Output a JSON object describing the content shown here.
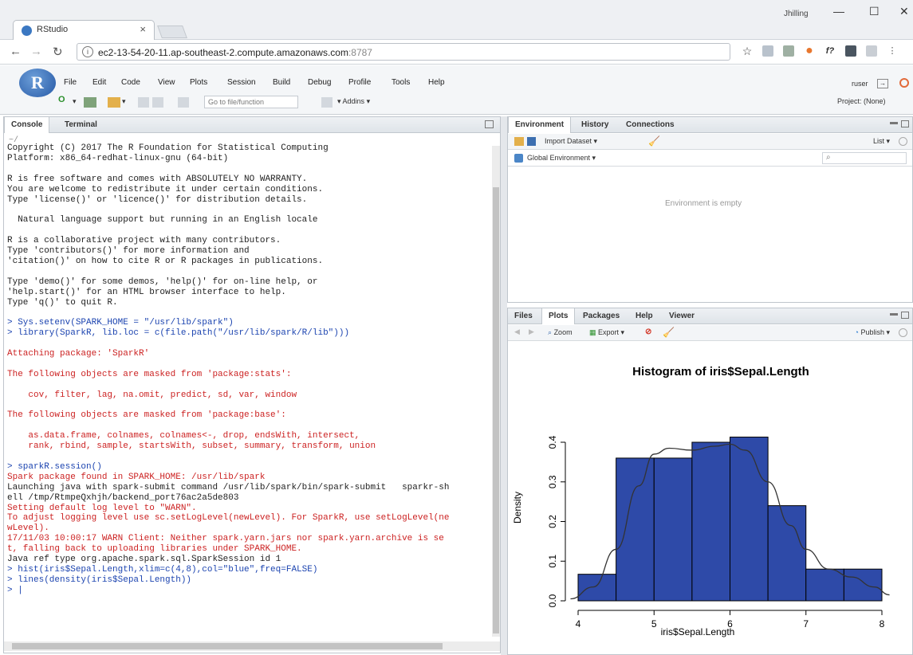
{
  "browser": {
    "tab_title": "RStudio",
    "tab_close": "×",
    "profile": "Jhilling",
    "win_minimize": "—",
    "win_maximize": "☐",
    "win_close": "✕",
    "url_host": "ec2-13-54-20-11.ap-southeast-2.compute.amazonaws.com",
    "url_port": ":8787"
  },
  "rstudio": {
    "menu": [
      "File",
      "Edit",
      "Code",
      "View",
      "Plots",
      "Session",
      "Build",
      "Debug",
      "Profile",
      "Tools",
      "Help"
    ],
    "goto_file": "Go to file/function",
    "addins": "Addins",
    "user": "ruser",
    "project": "Project: (None)"
  },
  "console": {
    "tabs": [
      "Console",
      "Terminal"
    ],
    "path": "~/",
    "lines": [
      {
        "t": "Copyright (C) 2017 The R Foundation for Statistical Computing",
        "c": "n"
      },
      {
        "t": "Platform: x86_64-redhat-linux-gnu (64-bit)",
        "c": "n"
      },
      {
        "t": "",
        "c": "n"
      },
      {
        "t": "R is free software and comes with ABSOLUTELY NO WARRANTY.",
        "c": "n"
      },
      {
        "t": "You are welcome to redistribute it under certain conditions.",
        "c": "n"
      },
      {
        "t": "Type 'license()' or 'licence()' for distribution details.",
        "c": "n"
      },
      {
        "t": "",
        "c": "n"
      },
      {
        "t": "  Natural language support but running in an English locale",
        "c": "n"
      },
      {
        "t": "",
        "c": "n"
      },
      {
        "t": "R is a collaborative project with many contributors.",
        "c": "n"
      },
      {
        "t": "Type 'contributors()' for more information and",
        "c": "n"
      },
      {
        "t": "'citation()' on how to cite R or R packages in publications.",
        "c": "n"
      },
      {
        "t": "",
        "c": "n"
      },
      {
        "t": "Type 'demo()' for some demos, 'help()' for on-line help, or",
        "c": "n"
      },
      {
        "t": "'help.start()' for an HTML browser interface to help.",
        "c": "n"
      },
      {
        "t": "Type 'q()' to quit R.",
        "c": "n"
      },
      {
        "t": "",
        "c": "n"
      },
      {
        "t": "> Sys.setenv(SPARK_HOME = \"/usr/lib/spark\")",
        "c": "b"
      },
      {
        "t": "> library(SparkR, lib.loc = c(file.path(\"/usr/lib/spark/R/lib\")))",
        "c": "b"
      },
      {
        "t": "",
        "c": "n"
      },
      {
        "t": "Attaching package: 'SparkR'",
        "c": "r"
      },
      {
        "t": "",
        "c": "n"
      },
      {
        "t": "The following objects are masked from 'package:stats':",
        "c": "r"
      },
      {
        "t": "",
        "c": "n"
      },
      {
        "t": "    cov, filter, lag, na.omit, predict, sd, var, window",
        "c": "r"
      },
      {
        "t": "",
        "c": "n"
      },
      {
        "t": "The following objects are masked from 'package:base':",
        "c": "r"
      },
      {
        "t": "",
        "c": "n"
      },
      {
        "t": "    as.data.frame, colnames, colnames<-, drop, endsWith, intersect,",
        "c": "r"
      },
      {
        "t": "    rank, rbind, sample, startsWith, subset, summary, transform, union",
        "c": "r"
      },
      {
        "t": "",
        "c": "n"
      },
      {
        "t": "> sparkR.session()",
        "c": "b"
      },
      {
        "t": "Spark package found in SPARK_HOME: /usr/lib/spark",
        "c": "r"
      },
      {
        "t": "Launching java with spark-submit command /usr/lib/spark/bin/spark-submit   sparkr-sh",
        "c": "n"
      },
      {
        "t": "ell /tmp/RtmpeQxhjh/backend_port76ac2a5de803",
        "c": "n"
      },
      {
        "t": "Setting default log level to \"WARN\".",
        "c": "r"
      },
      {
        "t": "To adjust logging level use sc.setLogLevel(newLevel). For SparkR, use setLogLevel(ne",
        "c": "r"
      },
      {
        "t": "wLevel).",
        "c": "r"
      },
      {
        "t": "17/11/03 10:00:17 WARN Client: Neither spark.yarn.jars nor spark.yarn.archive is se",
        "c": "r"
      },
      {
        "t": "t, falling back to uploading libraries under SPARK_HOME.",
        "c": "r"
      },
      {
        "t": "Java ref type org.apache.spark.sql.SparkSession id 1",
        "c": "n"
      },
      {
        "t": "> hist(iris$Sepal.Length,xlim=c(4,8),col=\"blue\",freq=FALSE)",
        "c": "b"
      },
      {
        "t": "> lines(density(iris$Sepal.Length))",
        "c": "b"
      },
      {
        "t": "> |",
        "c": "b"
      }
    ]
  },
  "environment": {
    "tabs": [
      "Environment",
      "History",
      "Connections"
    ],
    "import_dataset": "Import Dataset",
    "list_view": "List",
    "scope": "Global Environment",
    "empty_message": "Environment is empty"
  },
  "files": {
    "tabs": [
      "Files",
      "Plots",
      "Packages",
      "Help",
      "Viewer"
    ],
    "zoom": "Zoom",
    "export": "Export",
    "publish": "Publish"
  },
  "chart_data": {
    "type": "bar",
    "title": "Histogram of iris$Sepal.Length",
    "xlabel": "iris$Sepal.Length",
    "ylabel": "Density",
    "xlim": [
      4,
      8
    ],
    "ylim": [
      0,
      0.4
    ],
    "xticks": [
      "4",
      "5",
      "6",
      "7",
      "8"
    ],
    "yticks": [
      "0.0",
      "0.1",
      "0.2",
      "0.3",
      "0.4"
    ],
    "bar_color": "#2e4aa8",
    "bins": [
      {
        "x0": 4.0,
        "x1": 4.5,
        "density": 0.067
      },
      {
        "x0": 4.5,
        "x1": 5.0,
        "density": 0.36
      },
      {
        "x0": 5.0,
        "x1": 5.5,
        "density": 0.36
      },
      {
        "x0": 5.5,
        "x1": 6.0,
        "density": 0.4
      },
      {
        "x0": 6.0,
        "x1": 6.5,
        "density": 0.413
      },
      {
        "x0": 6.5,
        "x1": 7.0,
        "density": 0.24
      },
      {
        "x0": 7.0,
        "x1": 7.5,
        "density": 0.08
      },
      {
        "x0": 7.5,
        "x1": 8.0,
        "density": 0.08
      }
    ],
    "density_curve": [
      {
        "x": 3.9,
        "y": 0.005
      },
      {
        "x": 4.2,
        "y": 0.035
      },
      {
        "x": 4.5,
        "y": 0.13
      },
      {
        "x": 4.8,
        "y": 0.29
      },
      {
        "x": 5.0,
        "y": 0.37
      },
      {
        "x": 5.2,
        "y": 0.385
      },
      {
        "x": 5.5,
        "y": 0.38
      },
      {
        "x": 5.8,
        "y": 0.39
      },
      {
        "x": 6.0,
        "y": 0.395
      },
      {
        "x": 6.2,
        "y": 0.38
      },
      {
        "x": 6.5,
        "y": 0.3
      },
      {
        "x": 6.8,
        "y": 0.19
      },
      {
        "x": 7.0,
        "y": 0.13
      },
      {
        "x": 7.3,
        "y": 0.08
      },
      {
        "x": 7.6,
        "y": 0.06
      },
      {
        "x": 7.9,
        "y": 0.035
      },
      {
        "x": 8.1,
        "y": 0.015
      }
    ]
  }
}
